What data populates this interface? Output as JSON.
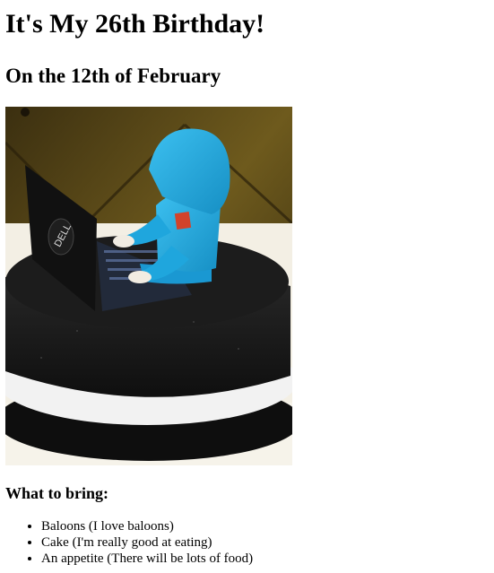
{
  "page": {
    "title": "It's My 26th Birthday!",
    "subtitle": "On the 12th of February",
    "image_logo_text": "DELL",
    "bring_heading": "What to bring:",
    "bring_items": [
      "Baloons (I love baloons)",
      "Cake (I'm really good at eating)",
      "An appetite (There will be lots of food)"
    ]
  },
  "colors": {
    "hoodie": "#1fa6dd",
    "cake": "#1a1a1a",
    "ribbon": "#f2f2f2",
    "background": "#6e5a1d"
  }
}
